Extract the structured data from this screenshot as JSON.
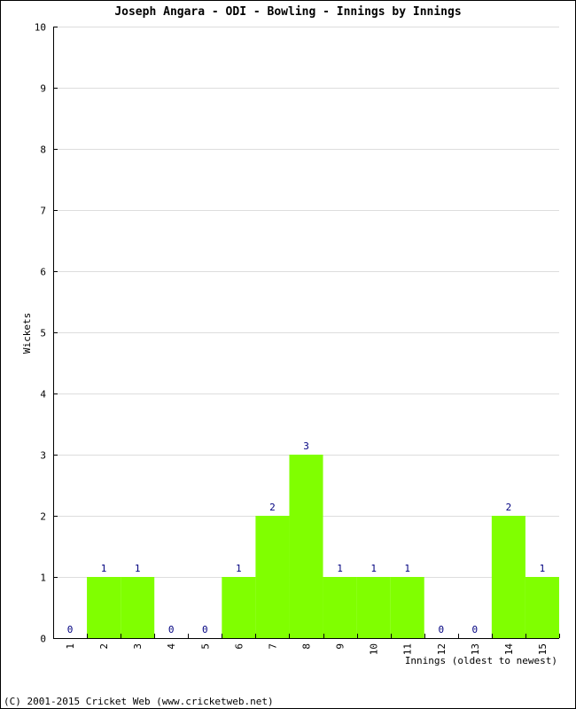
{
  "chart_data": {
    "type": "bar",
    "title": "Joseph Angara - ODI - Bowling - Innings by Innings",
    "xlabel": "Innings (oldest to newest)",
    "ylabel": "Wickets",
    "categories": [
      "1",
      "2",
      "3",
      "4",
      "5",
      "6",
      "7",
      "8",
      "9",
      "10",
      "11",
      "12",
      "13",
      "14",
      "15"
    ],
    "values": [
      0,
      1,
      1,
      0,
      0,
      1,
      2,
      3,
      1,
      1,
      1,
      0,
      0,
      2,
      1
    ],
    "ylim": [
      0,
      10
    ],
    "yticks": [
      0,
      1,
      2,
      3,
      4,
      5,
      6,
      7,
      8,
      9,
      10
    ],
    "grid": true,
    "bar_color": "#80ff00",
    "label_color": "#000080"
  },
  "footer": "(C) 2001-2015 Cricket Web (www.cricketweb.net)"
}
